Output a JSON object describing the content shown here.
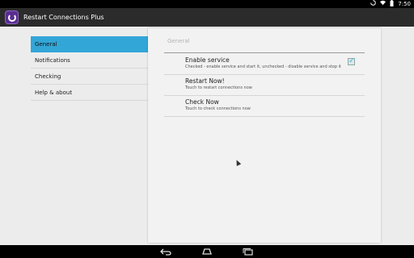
{
  "status_bar": {
    "time": "7:50"
  },
  "action_bar": {
    "title": "Restart Connections Plus"
  },
  "headers": [
    {
      "label": "General",
      "selected": true
    },
    {
      "label": "Notifications",
      "selected": false
    },
    {
      "label": "Checking",
      "selected": false
    },
    {
      "label": "Help & about",
      "selected": false
    }
  ],
  "detail": {
    "category": "General",
    "prefs": [
      {
        "title": "Enable service",
        "summary": "Checked - enable service and start it, unchecked - disable service and stop it",
        "checked": true
      },
      {
        "title": "Restart Now!",
        "summary": "Touch to restart connections now"
      },
      {
        "title": "Check Now",
        "summary": "Touch to check connections now"
      }
    ]
  },
  "colors": {
    "selected_header": "#33a6d8",
    "action_bar": "#2b2b2b",
    "app_icon": "#5a2c91"
  },
  "icons": [
    "sync-icon",
    "wifi-icon",
    "battery-icon",
    "app-icon",
    "back-icon",
    "home-icon",
    "recents-icon",
    "checkbox-checked-icon"
  ]
}
